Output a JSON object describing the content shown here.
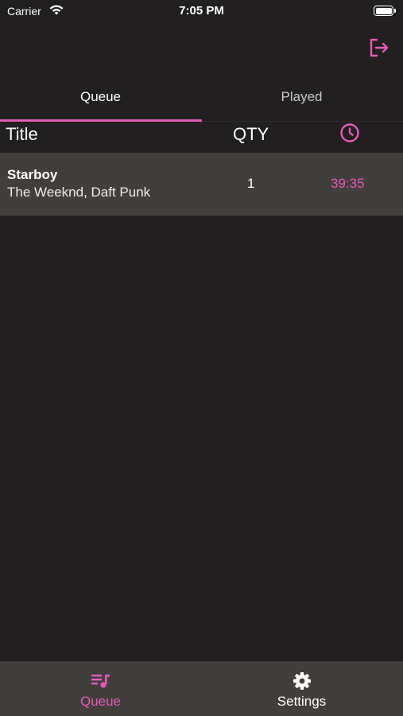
{
  "status_bar": {
    "carrier": "Carrier",
    "time": "7:05 PM",
    "icons": [
      "wifi-icon",
      "battery-icon"
    ]
  },
  "header": {
    "logout_icon": "logout-icon"
  },
  "tabs": [
    {
      "label": "Queue",
      "active": true
    },
    {
      "label": "Played",
      "active": false
    }
  ],
  "table": {
    "columns": {
      "title": "Title",
      "qty": "QTY",
      "time_icon": "clock-icon"
    },
    "rows": [
      {
        "title": "Starboy",
        "artist": "The Weeknd, Daft Punk",
        "qty": "1",
        "time": "39:35"
      }
    ]
  },
  "tabbar": {
    "items": [
      {
        "label": "Queue",
        "icon": "queue-music-icon",
        "active": true
      },
      {
        "label": "Settings",
        "icon": "gear-icon",
        "active": false
      }
    ]
  },
  "colors": {
    "accent": "#e35bb9",
    "background": "#211f20",
    "row_background": "#423e3c",
    "tabbar_background": "#423e3c"
  }
}
